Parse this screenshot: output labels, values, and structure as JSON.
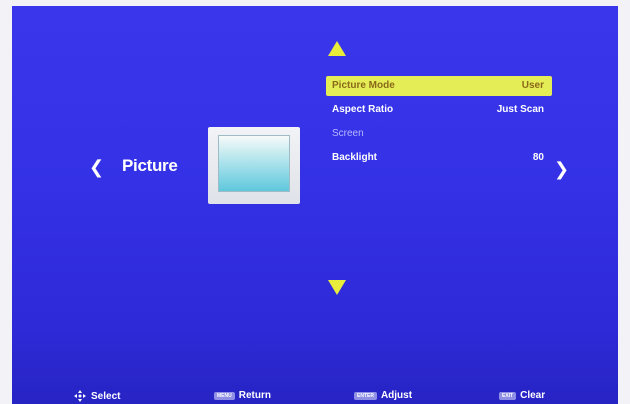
{
  "category": {
    "title": "Picture",
    "left_icon": "chevron-left-icon",
    "right_icon": "chevron-right-icon"
  },
  "preview_icon": "tv-icon",
  "menu": {
    "items": [
      {
        "label": "Picture Mode",
        "value": "User",
        "selected": true
      },
      {
        "label": "Aspect Ratio",
        "value": "Just Scan"
      },
      {
        "label": "Screen",
        "value": "",
        "disabled": true
      },
      {
        "label": "Backlight",
        "value": "80"
      }
    ],
    "scroll_up_icon": "triangle-up-icon",
    "scroll_down_icon": "triangle-down-icon"
  },
  "footer": {
    "select": {
      "icon": "dpad-icon",
      "label": "Select"
    },
    "return": {
      "key": "MENU",
      "label": "Return"
    },
    "adjust": {
      "key": "ENTER",
      "label": "Adjust"
    },
    "clear": {
      "key": "EXIT",
      "label": "Clear"
    }
  },
  "colors": {
    "background": "#3431e6",
    "highlight": "#e4ec56",
    "arrow": "#e8ec3a",
    "text": "#ffffff"
  }
}
